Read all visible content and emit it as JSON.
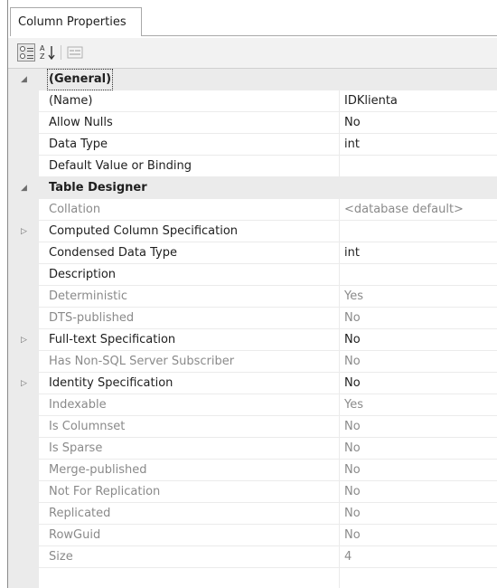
{
  "tab": {
    "label": "Column Properties"
  },
  "toolbar": {
    "categorized_icon": "categorized-icon",
    "alphabetical_icon": "alphabetical-sort-icon",
    "alphabetical_glyph_top": "A",
    "alphabetical_glyph_bottom": "Z",
    "property_pages_icon": "property-pages-icon"
  },
  "rows": [
    {
      "kind": "category",
      "expanded": true,
      "name": "(General)",
      "value": "",
      "selected": true
    },
    {
      "kind": "prop",
      "name": "(Name)",
      "value": "IDKlienta",
      "readonly": false
    },
    {
      "kind": "prop",
      "name": "Allow Nulls",
      "value": "No",
      "readonly": false
    },
    {
      "kind": "prop",
      "name": "Data Type",
      "value": "int",
      "readonly": false
    },
    {
      "kind": "prop",
      "name": "Default Value or Binding",
      "value": "",
      "readonly": false
    },
    {
      "kind": "category",
      "expanded": true,
      "name": "Table Designer",
      "value": ""
    },
    {
      "kind": "prop",
      "name": "Collation",
      "value": "<database default>",
      "readonly": true
    },
    {
      "kind": "prop",
      "expandable": true,
      "name": "Computed Column Specification",
      "value": "",
      "readonly": false
    },
    {
      "kind": "prop",
      "name": "Condensed Data Type",
      "value": "int",
      "readonly": false
    },
    {
      "kind": "prop",
      "name": "Description",
      "value": "",
      "readonly": false
    },
    {
      "kind": "prop",
      "name": "Deterministic",
      "value": "Yes",
      "readonly": true
    },
    {
      "kind": "prop",
      "name": "DTS-published",
      "value": "No",
      "readonly": true
    },
    {
      "kind": "prop",
      "expandable": true,
      "name": "Full-text Specification",
      "value": "No",
      "readonly": false
    },
    {
      "kind": "prop",
      "name": "Has Non-SQL Server Subscriber",
      "value": "No",
      "readonly": true
    },
    {
      "kind": "prop",
      "expandable": true,
      "name": "Identity Specification",
      "value": "No",
      "readonly": false
    },
    {
      "kind": "prop",
      "name": "Indexable",
      "value": "Yes",
      "readonly": true
    },
    {
      "kind": "prop",
      "name": "Is Columnset",
      "value": "No",
      "readonly": true
    },
    {
      "kind": "prop",
      "name": "Is Sparse",
      "value": "No",
      "readonly": true
    },
    {
      "kind": "prop",
      "name": "Merge-published",
      "value": "No",
      "readonly": true
    },
    {
      "kind": "prop",
      "name": "Not For Replication",
      "value": "No",
      "readonly": true
    },
    {
      "kind": "prop",
      "name": "Replicated",
      "value": "No",
      "readonly": true
    },
    {
      "kind": "prop",
      "name": "RowGuid",
      "value": "No",
      "readonly": true
    },
    {
      "kind": "prop",
      "name": "Size",
      "value": "4",
      "readonly": true
    }
  ]
}
